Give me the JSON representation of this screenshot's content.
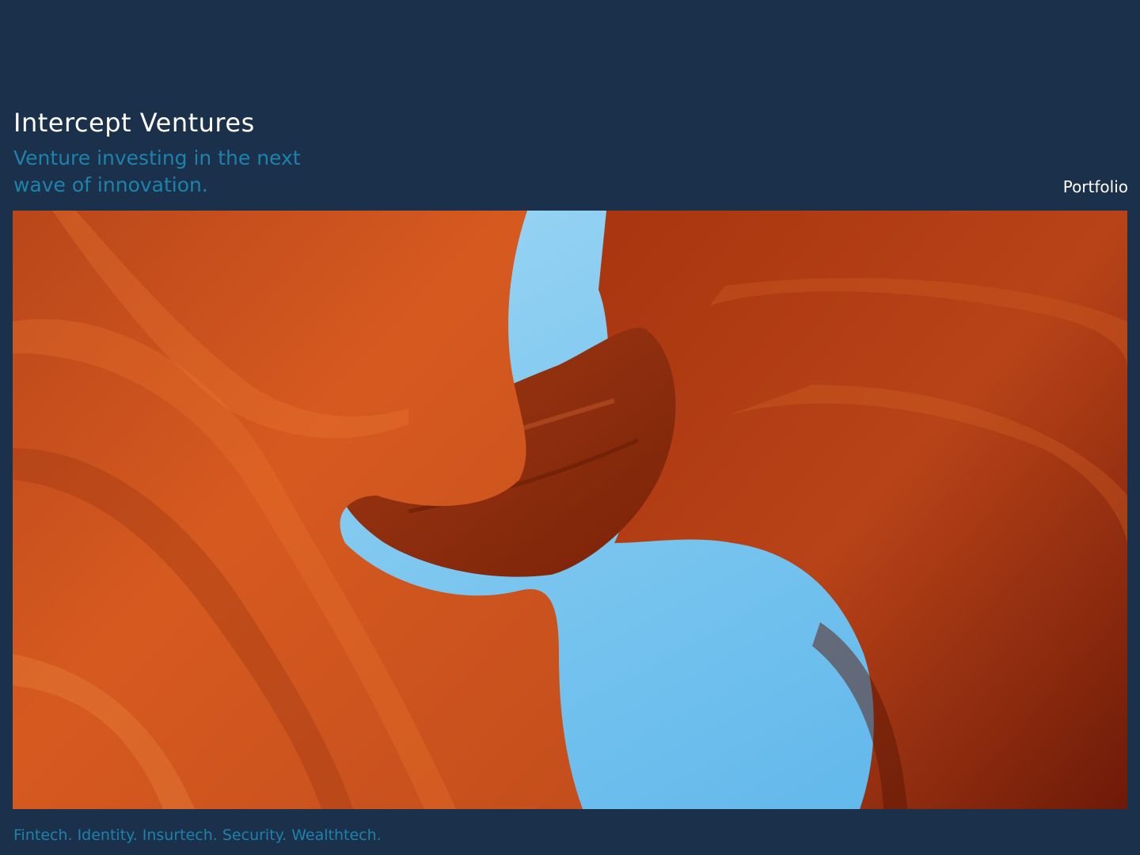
{
  "brand": {
    "name": "Intercept Ventures"
  },
  "tagline": "Venture investing in the next wave of innovation.",
  "nav": {
    "portfolio_label": "Portfolio"
  },
  "hero": {
    "description": "Antelope-canyon style orange sandstone walls opening to a blue sky"
  },
  "footer": {
    "sectors": "Fintech. Identity. Insurtech. Security. Wealthtech."
  },
  "colors": {
    "background": "#1b304a",
    "accent": "#1d82ac",
    "text": "#ffffff",
    "rock": "#c8501f",
    "sky": "#8fd0f2"
  }
}
